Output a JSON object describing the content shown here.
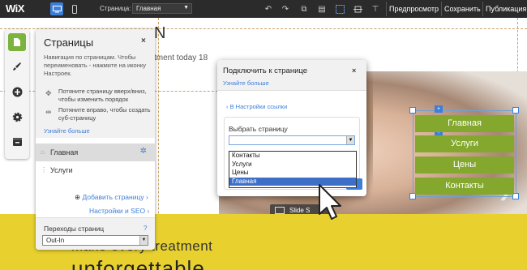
{
  "topbar": {
    "logo": "WiX",
    "page_label": "Страница:",
    "page_value": "Главная",
    "preview": "Предпросмотр",
    "save": "Сохранить",
    "publish": "Публикация"
  },
  "site": {
    "title": "N",
    "tagline": "tment today 18",
    "slide_label": "Slide S",
    "headline": "make every treatment",
    "headline2": "unforgettable",
    "menu": [
      "Главная",
      "Услуги",
      "Цены",
      "Контакты"
    ]
  },
  "pages_panel": {
    "title": "Страницы",
    "close": "×",
    "description": "Навигация по страницам. Чтобы переименовать - нажмите на иконку Настроек.",
    "hint1": "Потяните страницу вверх/вниз, чтобы изменить порядок",
    "hint2": "Потяните вправо, чтобы создать суб-страницу",
    "learn_more": "Узнайте больше",
    "pages": [
      "Главная",
      "Услуги"
    ],
    "add_page": "Добавить страницу",
    "seo": "Настройки и SEO",
    "transitions_label": "Переходы страниц",
    "transitions_help": "?",
    "transitions_value": "Out-In"
  },
  "dialog": {
    "title": "Подключить к странице",
    "close": "×",
    "learn_more": "Узнайте больше",
    "back": "В Настройки ссылки",
    "select_label": "Выбрать страницу",
    "select_value": "",
    "options": [
      "Контакты",
      "Услуги",
      "Цены",
      "Главная"
    ],
    "highlighted_option": "Главная"
  },
  "colors": {
    "topbar": "#2b2b2b",
    "accent": "#3d7fd8",
    "menu_green": "#84a82d",
    "active_tool": "#7bb33c",
    "yellow_band": "#e8d12f"
  }
}
